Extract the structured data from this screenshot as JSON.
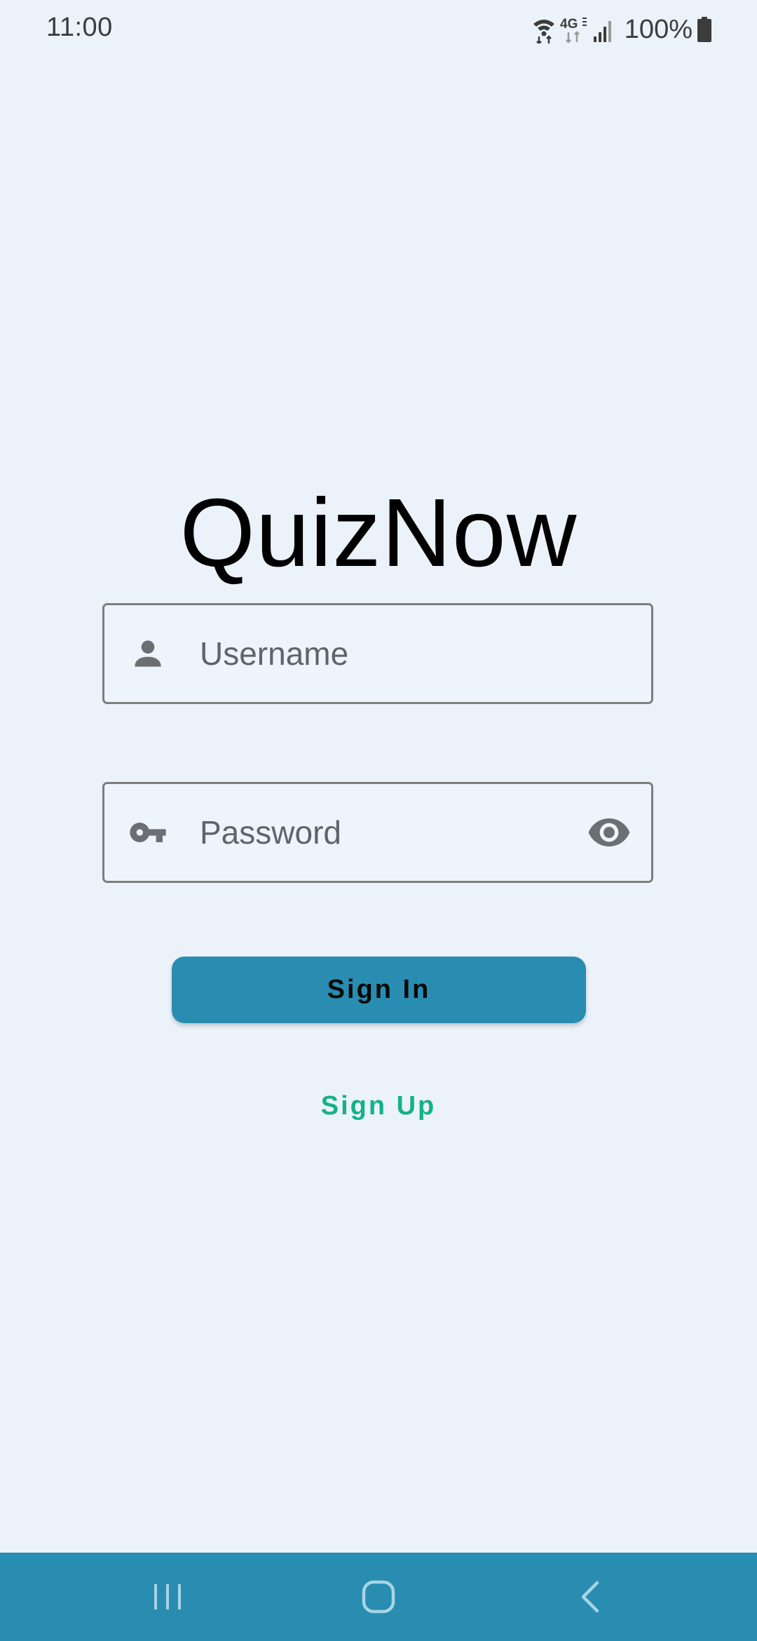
{
  "status_bar": {
    "time": "11:00",
    "network_label": "4G",
    "battery_level": "100%",
    "icons": [
      "wifi-icon",
      "mobile-data-icon",
      "signal-icon",
      "battery-icon"
    ]
  },
  "app": {
    "title": "QuizNow"
  },
  "login_form": {
    "username": {
      "placeholder": "Username",
      "value": "",
      "icon": "person-icon"
    },
    "password": {
      "placeholder": "Password",
      "value": "",
      "icon": "key-icon",
      "toggle_icon": "eye-icon"
    },
    "sign_in_label": "Sign In",
    "sign_up_label": "Sign Up"
  },
  "nav_bar": {
    "items": [
      "recents-icon",
      "home-icon",
      "back-icon"
    ]
  },
  "colors": {
    "background": "#ebf2fa",
    "primary": "#288db1",
    "accent": "#14b18a",
    "field_border": "#7d7d7d",
    "placeholder": "#5f6468"
  }
}
